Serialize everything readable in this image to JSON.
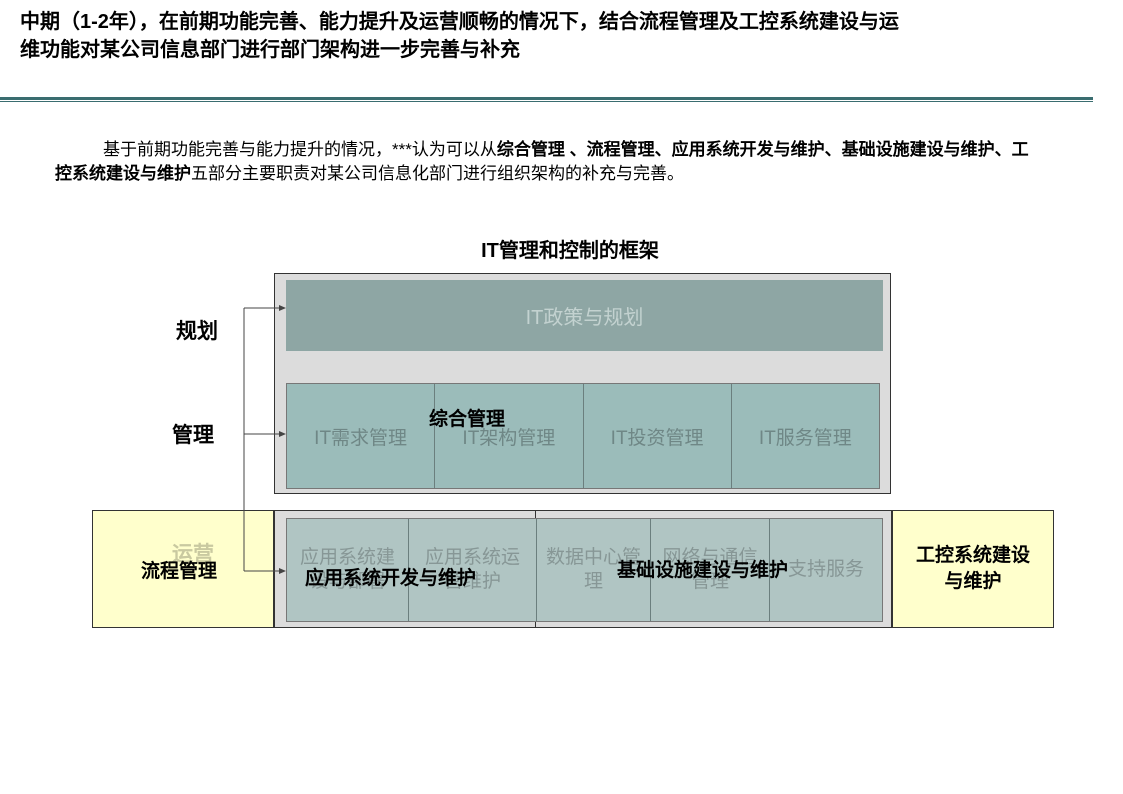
{
  "slide": {
    "title": "中期（1-2年），在前期功能完善、能力提升及运营顺畅的情况下，结合流程管理及工控系统建设与运维功能对某公司信息部门进行部门架构进一步完善与补充"
  },
  "intro": {
    "part1": "基于前期功能完善与能力提升的情况，***认为可以从",
    "bold1": "综合管理 、流程管理、应用系统开发与维护、基础设施建设与维护、工控系统建设与维护",
    "part2": "五部分主要职责对某公司信息化部门进行组织架构的补充与完善。"
  },
  "diagram": {
    "title": "IT管理和控制的框架",
    "side_labels": {
      "planning": "规划",
      "management": "管理",
      "operations": "运营"
    },
    "policy_bar": "IT政策与规划",
    "management_row": [
      "IT需求管理",
      "IT架构管理",
      "IT投资管理",
      "IT服务管理"
    ],
    "operations_row": [
      "应用系统建设与部署",
      "应用系统运营维护",
      "数据中心管理",
      "网络与通信管理",
      "支持服务"
    ],
    "overlay_labels": {
      "comprehensive": "综合管理",
      "process": "流程管理",
      "app_dev": "应用系统开发与维护",
      "infra": "基础设施建设与维护",
      "ics": "工控系统建设与维护"
    }
  },
  "colors": {
    "rule": "#3a6d70",
    "frame": "#dcdcdc",
    "policy": "#8ea6a4",
    "cell": "#9bbcba",
    "highlight": "#ffffcc"
  }
}
